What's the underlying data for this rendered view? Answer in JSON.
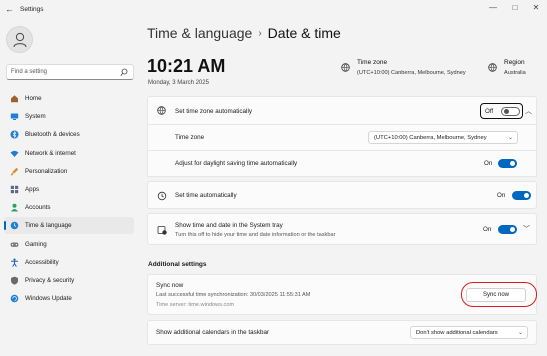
{
  "window": {
    "title": "Settings",
    "back": "←",
    "minimize": "—",
    "maximize": "□",
    "close": "✕"
  },
  "search": {
    "placeholder": "Find a setting"
  },
  "nav": [
    {
      "label": "Home",
      "icon": "home-icon",
      "color": "#a0612c"
    },
    {
      "label": "System",
      "icon": "monitor-icon",
      "color": "#1f7fd4"
    },
    {
      "label": "Bluetooth & devices",
      "icon": "bluetooth-icon",
      "color": "#1f7fd4"
    },
    {
      "label": "Network & internet",
      "icon": "wifi-icon",
      "color": "#1f7fd4"
    },
    {
      "label": "Personalization",
      "icon": "brush-icon",
      "color": "#e08a2c"
    },
    {
      "label": "Apps",
      "icon": "apps-icon",
      "color": "#5a6a88"
    },
    {
      "label": "Accounts",
      "icon": "person-icon",
      "color": "#2aa065"
    },
    {
      "label": "Time & language",
      "icon": "globe-clock-icon",
      "color": "#1f7fd4"
    },
    {
      "label": "Gaming",
      "icon": "gamepad-icon",
      "color": "#7a7a7a"
    },
    {
      "label": "Accessibility",
      "icon": "accessibility-icon",
      "color": "#1f5fb4"
    },
    {
      "label": "Privacy & security",
      "icon": "shield-icon",
      "color": "#6a6a6a"
    },
    {
      "label": "Windows Update",
      "icon": "update-icon",
      "color": "#1f7fd4"
    }
  ],
  "breadcrumb": {
    "parent": "Time & language",
    "separator": "›",
    "current": "Date & time"
  },
  "clock": {
    "time": "10:21 AM",
    "date": "Monday, 3 March 2025"
  },
  "header": {
    "timezone_label": "Time zone",
    "timezone_value": "(UTC+10:00) Canberra, Melbourne, Sydney",
    "region_label": "Region",
    "region_value": "Australia"
  },
  "settings": {
    "auto_timezone": {
      "label": "Set time zone automatically",
      "state": "Off"
    },
    "timezone": {
      "label": "Time zone",
      "value": "(UTC+10:00) Canberra, Melbourne, Sydney"
    },
    "dst": {
      "label": "Adjust for daylight saving time automatically",
      "state": "On"
    },
    "auto_time": {
      "label": "Set time automatically",
      "state": "On"
    },
    "tray": {
      "label": "Show time and date in the System tray",
      "desc": "Turn this off to hide your time and date information or the taskbar",
      "state": "On"
    }
  },
  "additional": {
    "title": "Additional settings",
    "sync": {
      "label": "Sync now",
      "last": "Last successful time synchronization: 30/03/2025 11:55:31 AM",
      "server": "Time server: time.windows.com",
      "button": "Sync now"
    },
    "calendars": {
      "label": "Show additional calendars in the taskbar",
      "value": "Don't show additional calendars"
    }
  },
  "colors": {
    "accent": "#0067c0",
    "annotation": "#d91b1b"
  }
}
